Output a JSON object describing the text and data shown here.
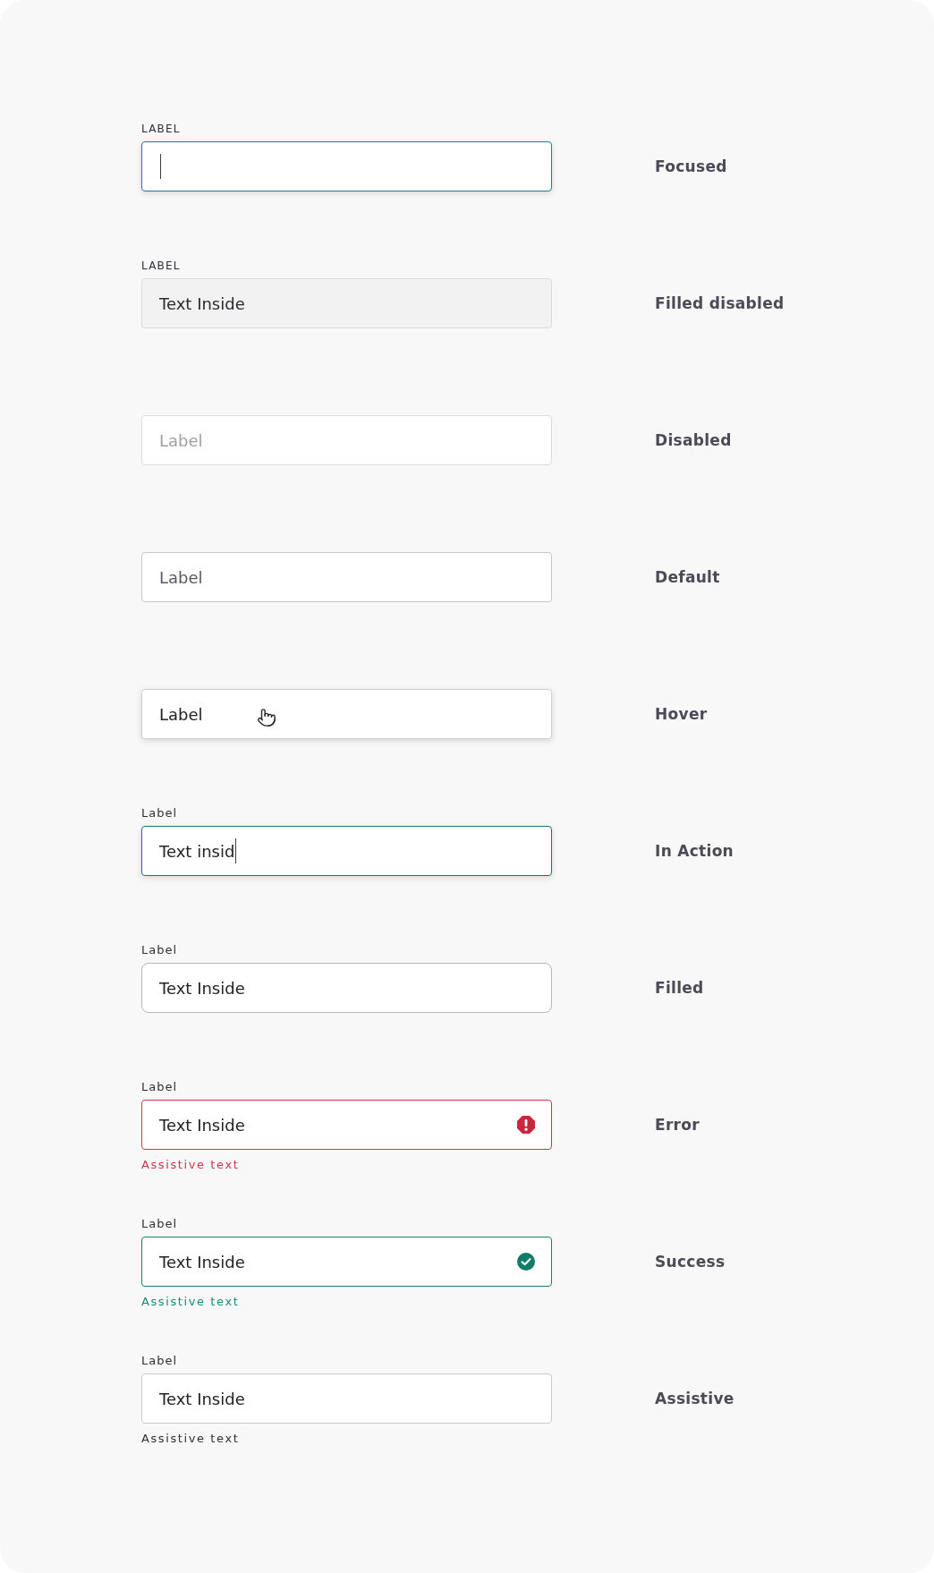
{
  "fields": [
    {
      "kind": "focused",
      "label": "LABEL",
      "caption": "Focused"
    },
    {
      "kind": "filled_disabled",
      "label": "LABEL",
      "value": "Text Inside",
      "caption": "Filled disabled"
    },
    {
      "kind": "disabled",
      "placeholder": "Label",
      "caption": "Disabled"
    },
    {
      "kind": "default",
      "placeholder": "Label",
      "caption": "Default"
    },
    {
      "kind": "hover",
      "placeholder": "Label",
      "caption": "Hover"
    },
    {
      "kind": "in_action",
      "label": "Label",
      "value": "Text insid",
      "caption": "In Action"
    },
    {
      "kind": "filled",
      "label": "Label",
      "value": "Text Inside",
      "caption": "Filled"
    },
    {
      "kind": "error",
      "label": "Label",
      "value": "Text Inside",
      "assistive": "Assistive text",
      "caption": "Error"
    },
    {
      "kind": "success",
      "label": "Label",
      "value": "Text Inside",
      "assistive": "Assistive text",
      "caption": "Success"
    },
    {
      "kind": "assistive",
      "label": "Label",
      "value": "Text Inside",
      "assistive": "Assistive text",
      "caption": "Assistive"
    }
  ]
}
